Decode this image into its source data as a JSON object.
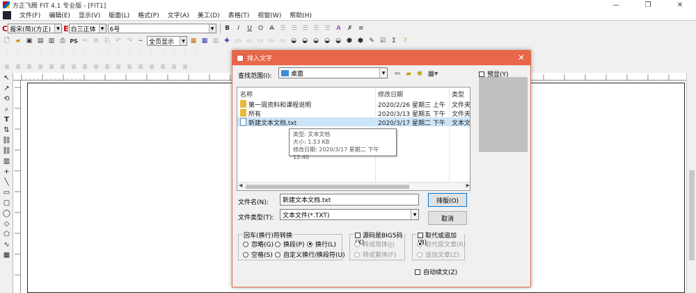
{
  "window": {
    "title": "方正飞腾 FIT 4.1 专业版 - [FIT1]",
    "min": "—",
    "max": "❐",
    "close": "✕"
  },
  "menu": [
    "文件(F)",
    "编辑(E)",
    "显示(V)",
    "版面(L)",
    "格式(P)",
    "文字(A)",
    "美工(D)",
    "表格(T)",
    "视窗(W)",
    "帮助(H)"
  ],
  "toolbar": {
    "c_label": "C",
    "font_cn": "报宋(简)(方正)",
    "e_label": "E",
    "font_en": "白三正体",
    "size": "6号",
    "bold": "B",
    "italic": "I",
    "underline": "U",
    "outline": "O",
    "strike": "A",
    "zoom": "全页显示",
    "ps": "PS"
  },
  "dialog": {
    "title": "排入文字",
    "close": "✕",
    "look_in_label": "查找范围(I):",
    "look_in_value": "桌面",
    "columns": {
      "name": "名称",
      "date": "修改日期",
      "type": "类型"
    },
    "files": [
      {
        "name": "第一周资料和课程说明",
        "date": "2020/2/26 星期三 上午 1...",
        "type": "文件夹",
        "kind": "folder"
      },
      {
        "name": "所有",
        "date": "2020/3/13 星期五 下午 1...",
        "type": "文件夹",
        "kind": "folder"
      },
      {
        "name": "新建文本文档.txt",
        "date": "2020/3/17 星期二 下午 1...",
        "type": "文本文",
        "kind": "doc"
      }
    ],
    "tooltip": {
      "type": "类型: 文本文档",
      "size": "大小: 1.53 KB",
      "modified": "修改日期: 2020/3/17 星期二 下午 12:40"
    },
    "filename_label": "文件名(N):",
    "filename_value": "新建文本文档.txt",
    "filetype_label": "文件类型(T):",
    "filetype_value": "文本文件(*.TXT)",
    "ok_button": "排版(O)",
    "cancel_button": "取消",
    "preview_label": "预显(Y)",
    "newline_group": {
      "title": "回车(换行)符转换",
      "options": [
        "忽略(G)",
        "换段(P)",
        "换行(L)",
        "空格(S)",
        "自定义换行/换段符(U)"
      ],
      "selected": "换行(L)"
    },
    "encoding_group": {
      "title": "源码是BIG5码(X)",
      "options": [
        "转成简体(J)",
        "转成繁体(F)"
      ]
    },
    "replace_group": {
      "title": "取代或追加(B)",
      "options": [
        "取代原文章(R)",
        "追加文章(Z)"
      ]
    },
    "auto_continue": "自动续文(Z)"
  }
}
